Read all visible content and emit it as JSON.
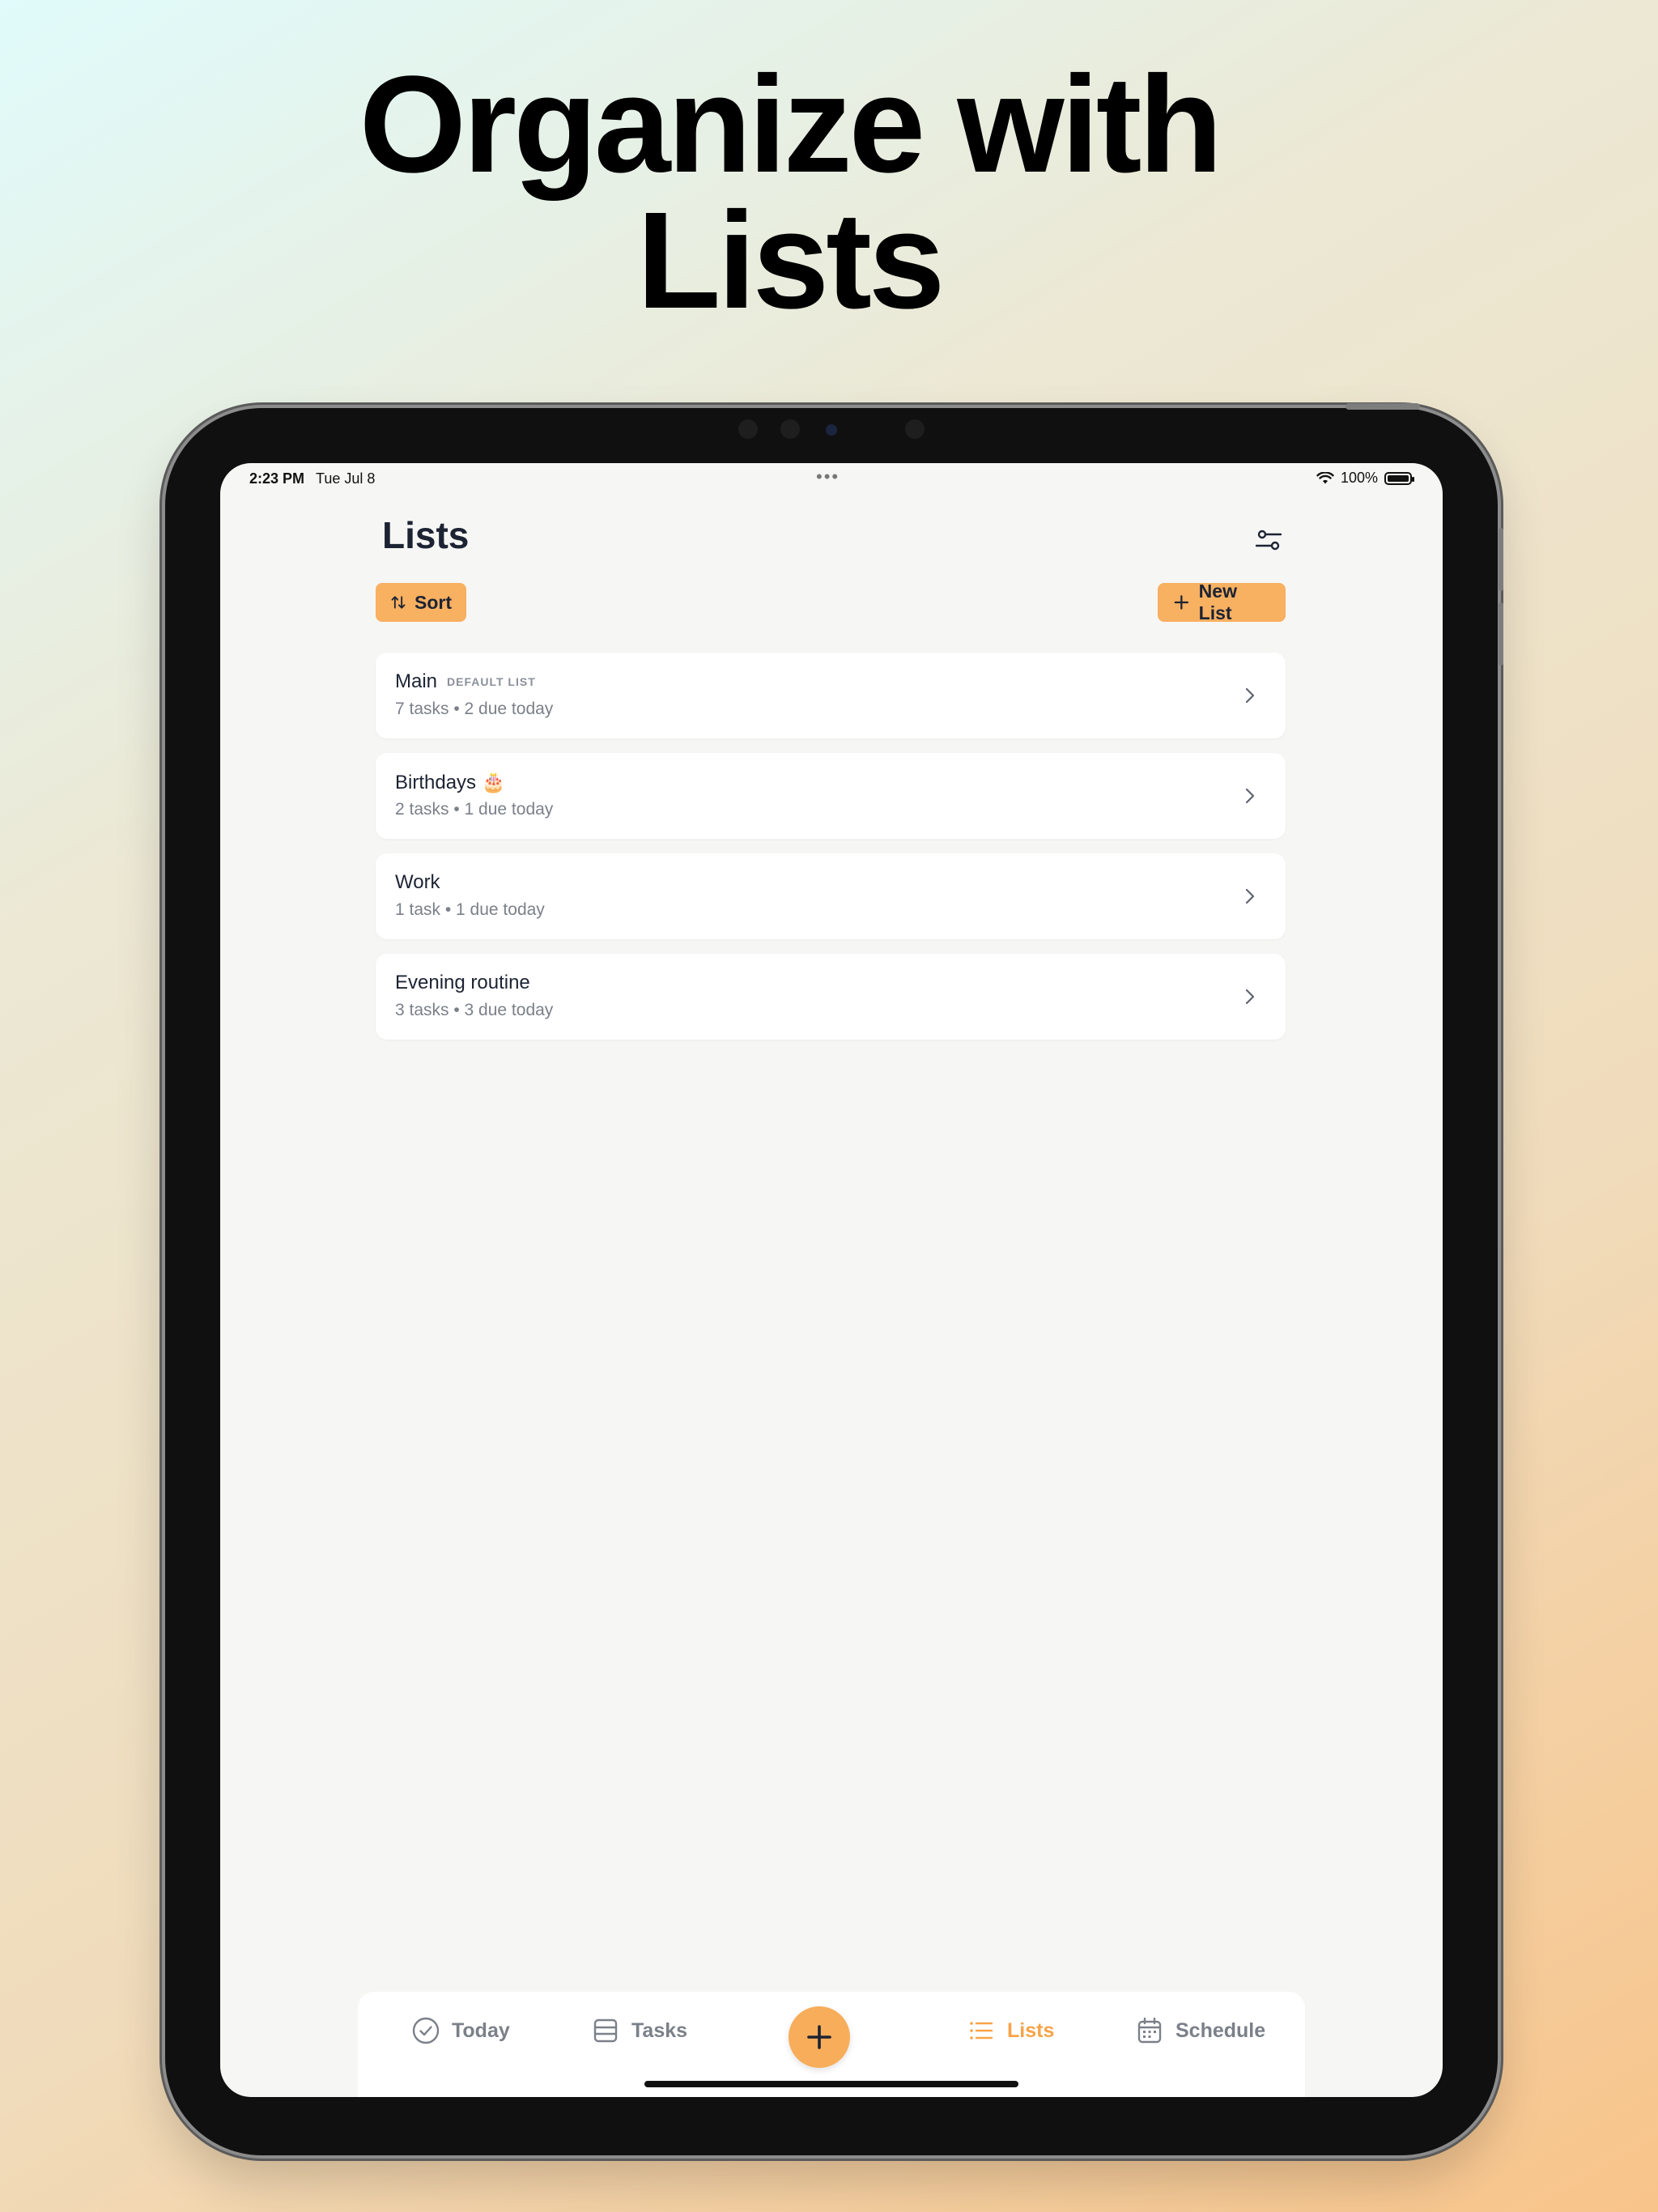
{
  "headline": {
    "line1": "Organize with",
    "line2": "Lists"
  },
  "status_bar": {
    "time": "2:23 PM",
    "date": "Tue Jul 8",
    "battery": "100%"
  },
  "page": {
    "title": "Lists"
  },
  "toolbar": {
    "sort_label": "Sort",
    "new_list_label": "New List"
  },
  "lists": [
    {
      "name": "Main",
      "badge": "DEFAULT LIST",
      "meta": "7 tasks • 2 due today"
    },
    {
      "name": "Birthdays 🎂",
      "badge": "",
      "meta": "2 tasks • 1 due today"
    },
    {
      "name": "Work",
      "badge": "",
      "meta": "1 task • 1 due today"
    },
    {
      "name": "Evening routine",
      "badge": "",
      "meta": "3 tasks • 3 due today"
    }
  ],
  "tabbar": {
    "today": "Today",
    "tasks": "Tasks",
    "lists": "Lists",
    "schedule": "Schedule",
    "active": "lists"
  },
  "colors": {
    "accent": "#f8b061",
    "active_tab": "#f8a348",
    "text": "#1c2333"
  },
  "icons": [
    "filter-icon",
    "sort-icon",
    "plus-icon",
    "chevron-right-icon",
    "check-circle-icon",
    "tasks-icon",
    "list-icon",
    "calendar-icon",
    "wifi-icon",
    "battery-icon"
  ]
}
